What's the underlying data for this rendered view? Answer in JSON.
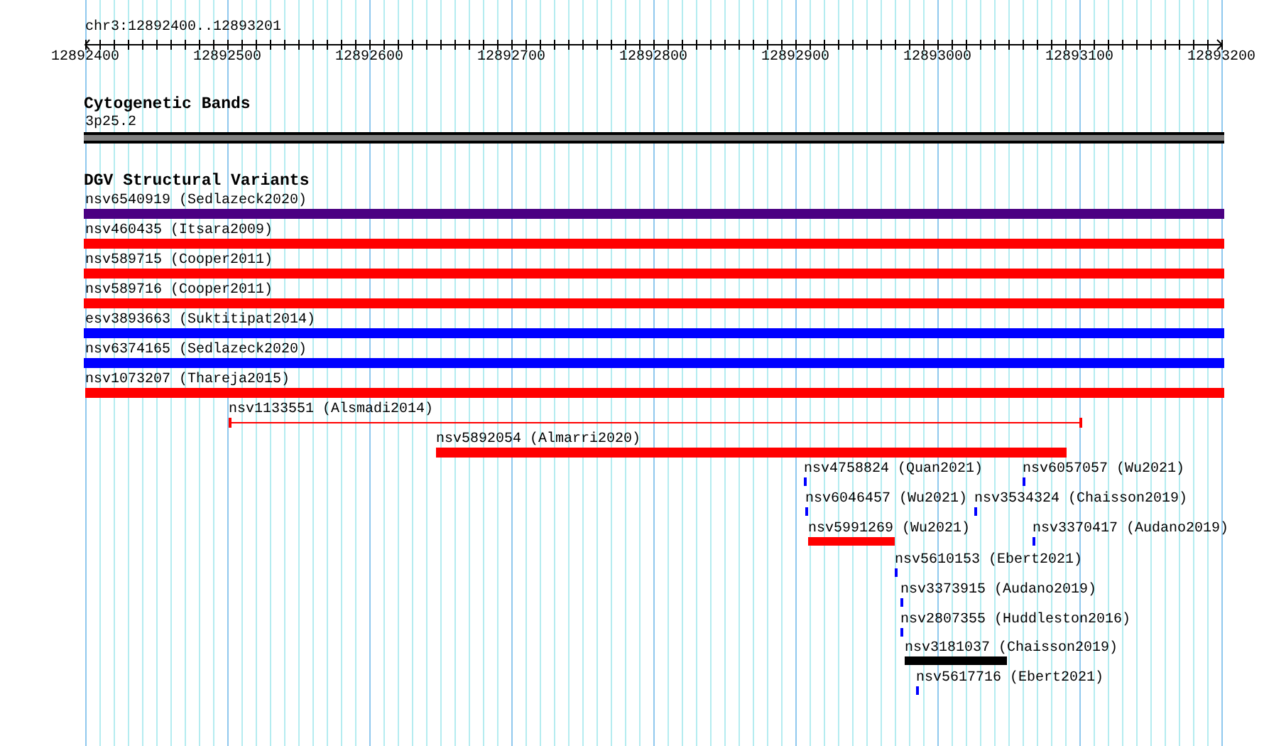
{
  "location": "chr3:12892400..12893201",
  "ruler": {
    "labels": [
      "12892400",
      "12892500",
      "12892600",
      "12892700",
      "12892800",
      "12892900",
      "12893000",
      "12893100",
      "12893200"
    ]
  },
  "tracks": [
    {
      "title": "Cytogenetic Bands",
      "features": [
        {
          "label": "3p25.2",
          "kind": "band",
          "color": "#808080"
        }
      ]
    },
    {
      "title": "DGV Structural Variants",
      "features": [
        {
          "label": "nsv6540919 (Sedlazeck2020)",
          "kind": "bar",
          "color": "#4b0082"
        },
        {
          "label": "nsv460435 (Itsara2009)",
          "kind": "bar",
          "color": "#ff0000"
        },
        {
          "label": "nsv589715 (Cooper2011)",
          "kind": "bar",
          "color": "#ff0000"
        },
        {
          "label": "nsv589716 (Cooper2011)",
          "kind": "bar",
          "color": "#ff0000"
        },
        {
          "label": "esv3893663 (Suktitipat2014)",
          "kind": "bar",
          "color": "#0000ff"
        },
        {
          "label": "nsv6374165 (Sedlazeck2020)",
          "kind": "bar",
          "color": "#0000ff"
        },
        {
          "label": "nsv1073207 (Thareja2015)",
          "kind": "bar",
          "color": "#ff0000"
        },
        {
          "label": "nsv1133551 (Alsmadi2014)",
          "kind": "line",
          "color": "#ff0000"
        },
        {
          "label": "nsv5892054 (Almarri2020)",
          "kind": "bar",
          "color": "#ff0000"
        },
        {
          "label": "nsv4758824 (Quan2021)",
          "kind": "bar",
          "color": "#0000ff"
        },
        {
          "label": "nsv6057057 (Wu2021)",
          "kind": "bar",
          "color": "#0000ff"
        },
        {
          "label": "nsv6046457 (Wu2021)",
          "kind": "bar",
          "color": "#0000ff"
        },
        {
          "label": "nsv3534324 (Chaisson2019)",
          "kind": "bar",
          "color": "#0000ff"
        },
        {
          "label": "nsv5991269 (Wu2021)",
          "kind": "bar",
          "color": "#ff0000"
        },
        {
          "label": "nsv3370417 (Audano2019)",
          "kind": "bar",
          "color": "#0000ff"
        },
        {
          "label": "nsv5610153 (Ebert2021)",
          "kind": "bar",
          "color": "#0000ff"
        },
        {
          "label": "nsv3373915 (Audano2019)",
          "kind": "bar",
          "color": "#0000ff"
        },
        {
          "label": "nsv2807355 (Huddleston2016)",
          "kind": "bar",
          "color": "#0000ff"
        },
        {
          "label": "nsv3181037 (Chaisson2019)",
          "kind": "bar",
          "color": "#000000"
        },
        {
          "label": "nsv5617716 (Ebert2021)",
          "kind": "bar",
          "color": "#0000ff"
        }
      ]
    }
  ]
}
